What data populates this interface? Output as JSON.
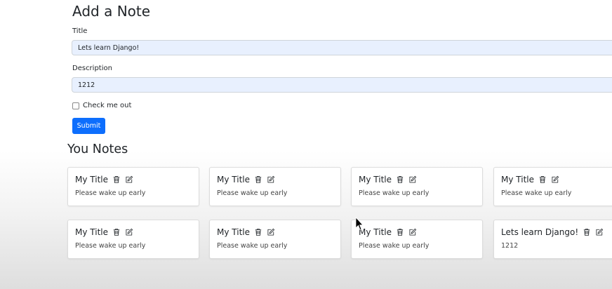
{
  "form": {
    "heading": "Add a Note",
    "title_label": "Title",
    "title_value": "Lets learn Django!",
    "description_label": "Description",
    "description_value": "1212",
    "checkbox_label": "Check me out",
    "submit_label": "Submit"
  },
  "notes_heading": "You Notes",
  "notes": [
    {
      "title": "My Title",
      "description": "Please wake up early"
    },
    {
      "title": "My Title",
      "description": "Please wake up early"
    },
    {
      "title": "My Title",
      "description": "Please wake up early"
    },
    {
      "title": "My Title",
      "description": "Please wake up early"
    },
    {
      "title": "My Title",
      "description": "Please wake up early"
    },
    {
      "title": "My Title",
      "description": "Please wake up early"
    },
    {
      "title": "My Title",
      "description": "Please wake up early"
    },
    {
      "title": "Lets learn Django!",
      "description": "1212"
    }
  ],
  "icons": {
    "delete": "trash-icon",
    "edit": "edit-icon",
    "cursor": "mouse-pointer-icon"
  },
  "colors": {
    "primary": "#0d6efd",
    "input_bg": "#e8f0fe"
  }
}
